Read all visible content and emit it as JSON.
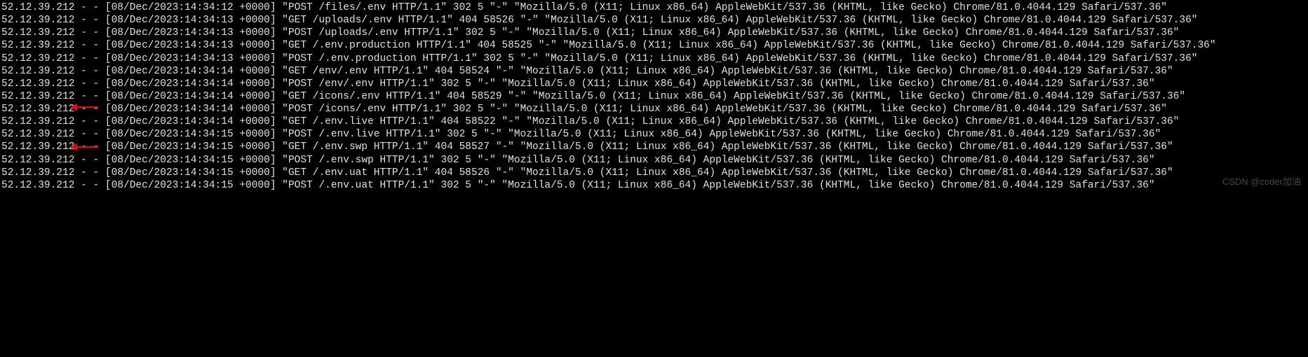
{
  "logs": [
    "52.12.39.212 - - [08/Dec/2023:14:34:12 +0000] \"POST /files/.env HTTP/1.1\" 302 5 \"-\" \"Mozilla/5.0 (X11; Linux x86_64) AppleWebKit/537.36 (KHTML, like Gecko) Chrome/81.0.4044.129 Safari/537.36\"",
    "52.12.39.212 - - [08/Dec/2023:14:34:13 +0000] \"GET /uploads/.env HTTP/1.1\" 404 58526 \"-\" \"Mozilla/5.0 (X11; Linux x86_64) AppleWebKit/537.36 (KHTML, like Gecko) Chrome/81.0.4044.129 Safari/537.36\"",
    "52.12.39.212 - - [08/Dec/2023:14:34:13 +0000] \"POST /uploads/.env HTTP/1.1\" 302 5 \"-\" \"Mozilla/5.0 (X11; Linux x86_64) AppleWebKit/537.36 (KHTML, like Gecko) Chrome/81.0.4044.129 Safari/537.36\"",
    "52.12.39.212 - - [08/Dec/2023:14:34:13 +0000] \"GET /.env.production HTTP/1.1\" 404 58525 \"-\" \"Mozilla/5.0 (X11; Linux x86_64) AppleWebKit/537.36 (KHTML, like Gecko) Chrome/81.0.4044.129 Safari/537.36\"",
    "52.12.39.212 - - [08/Dec/2023:14:34:13 +0000] \"POST /.env.production HTTP/1.1\" 302 5 \"-\" \"Mozilla/5.0 (X11; Linux x86_64) AppleWebKit/537.36 (KHTML, like Gecko) Chrome/81.0.4044.129 Safari/537.36\"",
    "52.12.39.212 - - [08/Dec/2023:14:34:14 +0000] \"GET /env/.env HTTP/1.1\" 404 58524 \"-\" \"Mozilla/5.0 (X11; Linux x86_64) AppleWebKit/537.36 (KHTML, like Gecko) Chrome/81.0.4044.129 Safari/537.36\"",
    "52.12.39.212 - - [08/Dec/2023:14:34:14 +0000] \"POST /env/.env HTTP/1.1\" 302 5 \"-\" \"Mozilla/5.0 (X11; Linux x86_64) AppleWebKit/537.36 (KHTML, like Gecko) Chrome/81.0.4044.129 Safari/537.36\"",
    "52.12.39.212 - - [08/Dec/2023:14:34:14 +0000] \"GET /icons/.env HTTP/1.1\" 404 58529 \"-\" \"Mozilla/5.0 (X11; Linux x86_64) AppleWebKit/537.36 (KHTML, like Gecko) Chrome/81.0.4044.129 Safari/537.36\"",
    "52.12.39.212 - - [08/Dec/2023:14:34:14 +0000] \"POST /icons/.env HTTP/1.1\" 302 5 \"-\" \"Mozilla/5.0 (X11; Linux x86_64) AppleWebKit/537.36 (KHTML, like Gecko) Chrome/81.0.4044.129 Safari/537.36\"",
    "52.12.39.212 - - [08/Dec/2023:14:34:14 +0000] \"GET /.env.live HTTP/1.1\" 404 58522 \"-\" \"Mozilla/5.0 (X11; Linux x86_64) AppleWebKit/537.36 (KHTML, like Gecko) Chrome/81.0.4044.129 Safari/537.36\"",
    "52.12.39.212 - - [08/Dec/2023:14:34:15 +0000] \"POST /.env.live HTTP/1.1\" 302 5 \"-\" \"Mozilla/5.0 (X11; Linux x86_64) AppleWebKit/537.36 (KHTML, like Gecko) Chrome/81.0.4044.129 Safari/537.36\"",
    "52.12.39.212 - - [08/Dec/2023:14:34:15 +0000] \"GET /.env.swp HTTP/1.1\" 404 58527 \"-\" \"Mozilla/5.0 (X11; Linux x86_64) AppleWebKit/537.36 (KHTML, like Gecko) Chrome/81.0.4044.129 Safari/537.36\"",
    "52.12.39.212 - - [08/Dec/2023:14:34:15 +0000] \"POST /.env.swp HTTP/1.1\" 302 5 \"-\" \"Mozilla/5.0 (X11; Linux x86_64) AppleWebKit/537.36 (KHTML, like Gecko) Chrome/81.0.4044.129 Safari/537.36\"",
    "52.12.39.212 - - [08/Dec/2023:14:34:15 +0000] \"GET /.env.uat HTTP/1.1\" 404 58526 \"-\" \"Mozilla/5.0 (X11; Linux x86_64) AppleWebKit/537.36 (KHTML, like Gecko) Chrome/81.0.4044.129 Safari/537.36\"",
    "52.12.39.212 - - [08/Dec/2023:14:34:15 +0000] \"POST /.env.uat HTTP/1.1\" 302 5 \"-\" \"Mozilla/5.0 (X11; Linux x86_64) AppleWebKit/537.36 (KHTML, like Gecko) Chrome/81.0.4044.129 Safari/537.36\""
  ],
  "annotations": {
    "arrow_color": "#ff0000"
  },
  "watermark": "CSDN @coder加油"
}
